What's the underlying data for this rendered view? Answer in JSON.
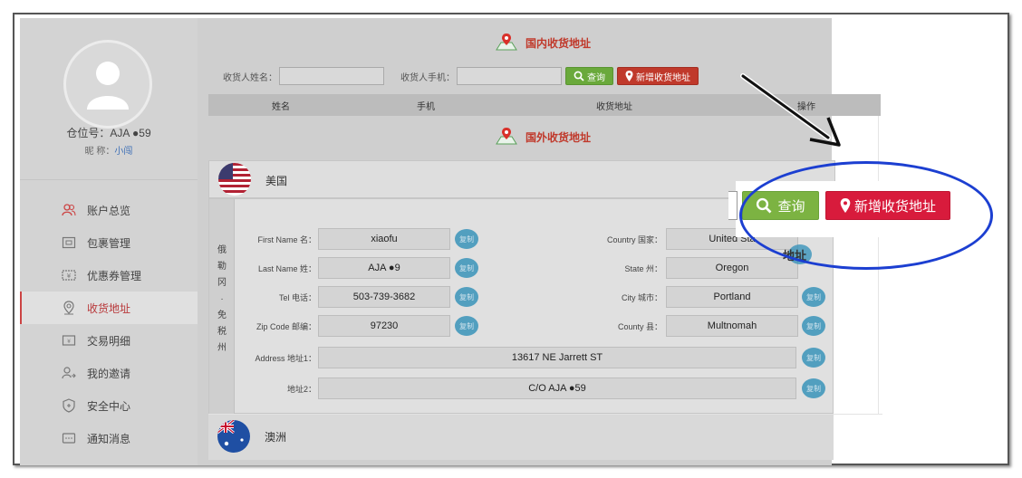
{
  "user": {
    "id_label": "仓位号：",
    "id_value": "AJA ●59",
    "nick_label": "昵 称：",
    "nick_value": "小闯"
  },
  "sidebar": {
    "items": [
      {
        "label": "账户总览",
        "icon": "users-icon"
      },
      {
        "label": "包裹管理",
        "icon": "package-icon"
      },
      {
        "label": "优惠券管理",
        "icon": "coupon-icon"
      },
      {
        "label": "收货地址",
        "icon": "location-icon",
        "active": true
      },
      {
        "label": "交易明细",
        "icon": "transaction-icon"
      },
      {
        "label": "我的邀请",
        "icon": "invite-icon"
      },
      {
        "label": "安全中心",
        "icon": "shield-icon"
      },
      {
        "label": "通知消息",
        "icon": "message-icon"
      }
    ]
  },
  "domestic": {
    "title": "国内收货地址",
    "name_label": "收货人姓名：",
    "name_value": "",
    "phone_label": "收货人手机：",
    "phone_value": "",
    "query_label": "查询",
    "add_label": "新增收货地址",
    "columns": [
      "姓名",
      "手机",
      "收货地址",
      "操作"
    ]
  },
  "foreign": {
    "title": "国外收货地址",
    "countries": [
      {
        "name": "美国",
        "region_label": "俄勒冈·免税州",
        "fields": {
          "first_name_label": "First Name 名：",
          "first_name": "xiaofu",
          "last_name_label": "Last Name 姓：",
          "last_name": "AJA ●9",
          "tel_label": "Tel 电话：",
          "tel": "503-739-3682",
          "zip_label": "Zip Code 邮编：",
          "zip": "97230",
          "country_label": "Country 国家：",
          "country": "United Sta",
          "state_label": "State 州：",
          "state": "Oregon",
          "city_label": "City 城市：",
          "city": "Portland",
          "county_label": "County 县：",
          "county": "Multnomah",
          "address1_label": "Address 地址1：",
          "address1": "13617 NE Jarrett ST",
          "address2_label": "地址2：",
          "address2": "C/O AJA ●59"
        },
        "copy_label": "复制"
      },
      {
        "name": "澳洲"
      }
    ]
  },
  "callout": {
    "query_label": "查询",
    "add_label": "新增收货地址",
    "partial_text": "地址"
  },
  "colors": {
    "accent_red": "#c0392b",
    "query_green": "#7cb342",
    "add_red": "#d81b3c",
    "callout_blue": "#1c3fd1",
    "copy_blue": "#2f8fb8"
  }
}
